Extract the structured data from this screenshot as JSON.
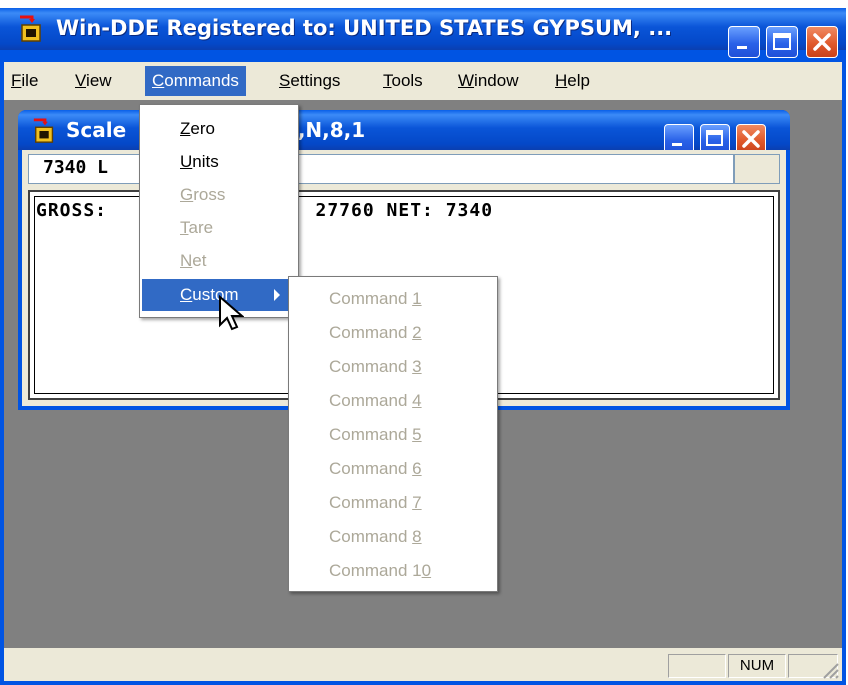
{
  "main_window": {
    "title": "Win-DDE  Registered to: UNITED STATES GYPSUM, ..."
  },
  "menubar": {
    "items": [
      {
        "ul": "F",
        "rest": "ile"
      },
      {
        "ul": "V",
        "rest": "iew"
      },
      {
        "ul": "C",
        "rest": "ommands"
      },
      {
        "ul": "S",
        "rest": "ettings"
      },
      {
        "ul": "T",
        "rest": "ools"
      },
      {
        "ul": "W",
        "rest": "indow"
      },
      {
        "ul": "H",
        "rest": "elp"
      }
    ],
    "active_index": 2
  },
  "child_window": {
    "title_left": "Scale",
    "title_right": "00,N,8,1",
    "units_value": "7340 L",
    "display_left": "GROSS:",
    "display_right": "E: 27760 NET: 7340"
  },
  "commands_menu": {
    "items": [
      {
        "pre": "",
        "ul": "Z",
        "rest": "ero",
        "enabled": true
      },
      {
        "pre": "",
        "ul": "U",
        "rest": "nits",
        "enabled": true
      },
      {
        "pre": "",
        "ul": "G",
        "rest": "ross",
        "enabled": false
      },
      {
        "pre": "",
        "ul": "T",
        "rest": "are",
        "enabled": false
      },
      {
        "pre": "",
        "ul": "N",
        "rest": "et",
        "enabled": false
      },
      {
        "pre": "",
        "ul": "C",
        "rest": "ustom",
        "enabled": true,
        "submenu": true,
        "selected": true
      }
    ]
  },
  "custom_submenu": {
    "items": [
      {
        "pre": "Command ",
        "ul": "1",
        "rest": ""
      },
      {
        "pre": "Command ",
        "ul": "2",
        "rest": ""
      },
      {
        "pre": "Command ",
        "ul": "3",
        "rest": ""
      },
      {
        "pre": "Command ",
        "ul": "4",
        "rest": ""
      },
      {
        "pre": "Command ",
        "ul": "5",
        "rest": ""
      },
      {
        "pre": "Command ",
        "ul": "6",
        "rest": ""
      },
      {
        "pre": "Command ",
        "ul": "7",
        "rest": ""
      },
      {
        "pre": "Command ",
        "ul": "8",
        "rest": ""
      },
      {
        "pre": "Command 1",
        "ul": "0",
        "rest": ""
      }
    ],
    "enabled": false
  },
  "statusbar": {
    "num": "NUM"
  },
  "colors": {
    "title_blue": "#0054e3",
    "menu_bg": "#ece9d8",
    "highlight": "#316ac5",
    "disabled_text": "#aca899",
    "mdi_bg": "#808080",
    "close_red": "#e05a2c"
  },
  "icons": [
    "app-icon",
    "minimize-icon",
    "maximize-icon",
    "close-icon",
    "submenu-arrow-icon",
    "mouse-cursor-icon",
    "size-grip-icon"
  ]
}
